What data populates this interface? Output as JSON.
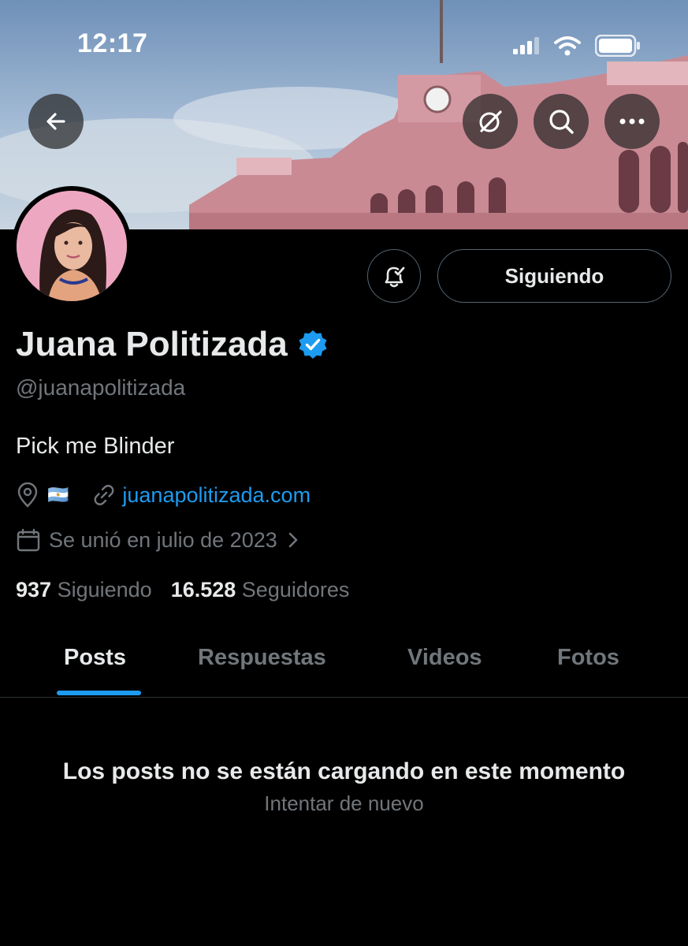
{
  "status_bar": {
    "time": "12:17"
  },
  "profile": {
    "name": "Juana Politizada",
    "handle": "@juanapolitizada",
    "bio": "Pick me Blinder",
    "location_flag": "🇦🇷",
    "website": "juanapolitizada.com",
    "joined": "Se unió en julio de 2023",
    "following_count": "937",
    "following_label": "Siguiendo",
    "followers_count": "16.528",
    "followers_label": "Seguidores"
  },
  "follow_button": {
    "label": "Siguiendo"
  },
  "tabs": [
    {
      "label": "Posts",
      "active": true
    },
    {
      "label": "Respuestas",
      "active": false
    },
    {
      "label": "Videos",
      "active": false
    },
    {
      "label": "Fotos",
      "active": false
    }
  ],
  "feed": {
    "error_message": "Los posts no se están cargando en este momento",
    "retry_label": "Intentar de nuevo"
  },
  "colors": {
    "accent": "#1d9bf0",
    "muted": "#71767b",
    "background": "#000000"
  }
}
